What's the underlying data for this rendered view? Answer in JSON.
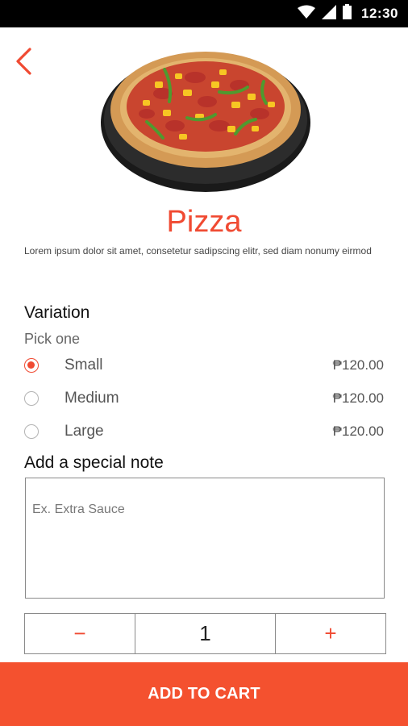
{
  "status_bar": {
    "time": "12:30",
    "icons": [
      "wifi-icon",
      "cellular-signal-icon",
      "battery-icon"
    ]
  },
  "header": {
    "back_icon": "chevron-left-icon"
  },
  "product": {
    "title": "Pizza",
    "description": "Lorem ipsum dolor sit amet, consetetur sadipscing elitr, sed diam nonumy eirmod",
    "image": "pizza-photo"
  },
  "variation": {
    "title": "Variation",
    "subtitle": "Pick one",
    "options": [
      {
        "label": "Small",
        "price": "₱120.00",
        "selected": true
      },
      {
        "label": "Medium",
        "price": "₱120.00",
        "selected": false
      },
      {
        "label": "Large",
        "price": "₱120.00",
        "selected": false
      }
    ]
  },
  "special_note": {
    "title": "Add a special note",
    "placeholder": "Ex. Extra Sauce",
    "value": ""
  },
  "quantity": {
    "minus_label": "−",
    "value": "1",
    "plus_label": "+"
  },
  "cart": {
    "button_label": "ADD TO CART"
  },
  "colors": {
    "accent": "#f04a32",
    "button": "#f4512f",
    "status_bar": "#000000"
  }
}
